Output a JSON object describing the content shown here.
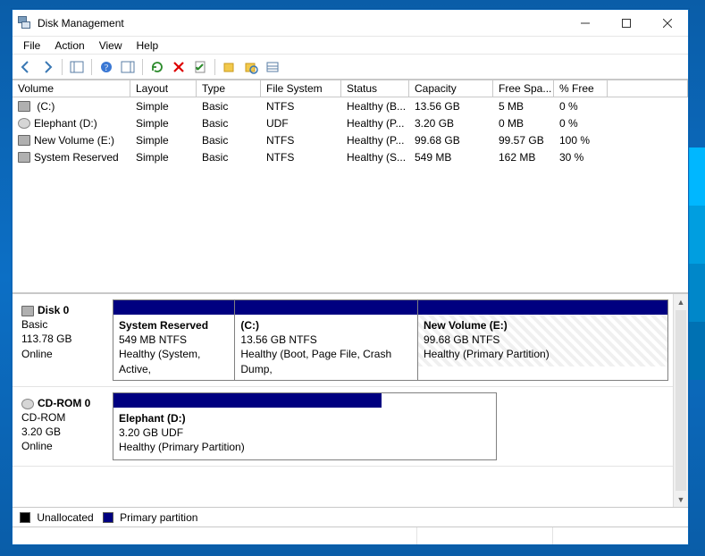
{
  "window": {
    "title": "Disk Management"
  },
  "menu": {
    "file": "File",
    "action": "Action",
    "view": "View",
    "help": "Help"
  },
  "columns": {
    "volume": "Volume",
    "layout": "Layout",
    "type": "Type",
    "fs": "File System",
    "status": "Status",
    "capacity": "Capacity",
    "free": "Free Spa...",
    "pct": "% Free"
  },
  "volumes": [
    {
      "icon": "drive",
      "name": " (C:)",
      "layout": "Simple",
      "type": "Basic",
      "fs": "NTFS",
      "status": "Healthy (B...",
      "capacity": "13.56 GB",
      "free": "5 MB",
      "pct": "0 %"
    },
    {
      "icon": "cd",
      "name": "Elephant (D:)",
      "layout": "Simple",
      "type": "Basic",
      "fs": "UDF",
      "status": "Healthy (P...",
      "capacity": "3.20 GB",
      "free": "0 MB",
      "pct": "0 %"
    },
    {
      "icon": "drive",
      "name": "New Volume (E:)",
      "layout": "Simple",
      "type": "Basic",
      "fs": "NTFS",
      "status": "Healthy (P...",
      "capacity": "99.68 GB",
      "free": "99.57 GB",
      "pct": "100 %"
    },
    {
      "icon": "drive",
      "name": "System Reserved",
      "layout": "Simple",
      "type": "Basic",
      "fs": "NTFS",
      "status": "Healthy (S...",
      "capacity": "549 MB",
      "free": "162 MB",
      "pct": "30 %"
    }
  ],
  "disks": [
    {
      "title": "Disk 0",
      "kind": "Basic",
      "size": "113.78 GB",
      "state": "Online",
      "icon": "drive",
      "parts": [
        {
          "name": "System Reserved",
          "size": "549 MB NTFS",
          "status": "Healthy (System, Active,",
          "width": "22%",
          "selected": false
        },
        {
          "name": " (C:)",
          "size": "13.56 GB NTFS",
          "status": "Healthy (Boot, Page File, Crash Dump,",
          "width": "33%",
          "selected": false
        },
        {
          "name": "New Volume  (E:)",
          "size": "99.68 GB NTFS",
          "status": "Healthy (Primary Partition)",
          "width": "45%",
          "selected": true
        }
      ]
    },
    {
      "title": "CD-ROM 0",
      "kind": "CD-ROM",
      "size": "3.20 GB",
      "state": "Online",
      "icon": "cd",
      "parts": [
        {
          "name": "Elephant  (D:)",
          "size": "3.20 GB UDF",
          "status": "Healthy (Primary Partition)",
          "width": "70%",
          "selected": false
        }
      ]
    }
  ],
  "legend": {
    "unallocated": "Unallocated",
    "primary": "Primary partition"
  }
}
